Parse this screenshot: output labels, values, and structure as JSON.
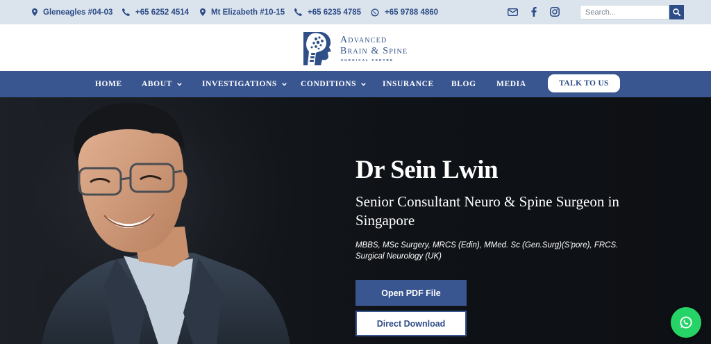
{
  "topbar": {
    "contacts": [
      {
        "icon": "location-pin-icon",
        "label": "Gleneagles #04-03"
      },
      {
        "icon": "phone-icon",
        "label": "+65 6252 4514"
      },
      {
        "icon": "location-pin-icon",
        "label": "Mt Elizabeth #10-15"
      },
      {
        "icon": "phone-icon",
        "label": "+65 6235 4785"
      },
      {
        "icon": "whatsapp-icon",
        "label": "+65 9788 4860"
      }
    ],
    "social": [
      "email-icon",
      "facebook-icon",
      "instagram-icon"
    ],
    "search": {
      "placeholder": "Search...",
      "icon": "search-icon"
    }
  },
  "logo": {
    "line1": "Advanced",
    "line2": "Brain & Spine",
    "line3": "SURGICAL CENTRE"
  },
  "nav": {
    "items": [
      {
        "label": "HOME",
        "dropdown": false
      },
      {
        "label": "ABOUT",
        "dropdown": true
      },
      {
        "label": "INVESTIGATIONS",
        "dropdown": true
      },
      {
        "label": "CONDITIONS",
        "dropdown": true
      },
      {
        "label": "INSURANCE",
        "dropdown": false
      },
      {
        "label": "BLOG",
        "dropdown": false
      },
      {
        "label": "MEDIA",
        "dropdown": false
      }
    ],
    "cta": "TALK TO US"
  },
  "hero": {
    "name": "Dr Sein Lwin",
    "subtitle": "Senior Consultant Neuro & Spine Surgeon in Singapore",
    "credentials": "MBBS, MSc Surgery, MRCS (Edin), MMed. Sc (Gen.Surg)(S'pore), FRCS. Surgical Neurology (UK)",
    "primary_button": "Open PDF File",
    "secondary_button": "Direct Download"
  },
  "floating": {
    "icon": "whatsapp-icon"
  },
  "colors": {
    "brand_blue": "#3a5690",
    "topbar_bg": "#dbe4ec",
    "hero_bg": "#0f1216",
    "whatsapp_green": "#25d366"
  }
}
